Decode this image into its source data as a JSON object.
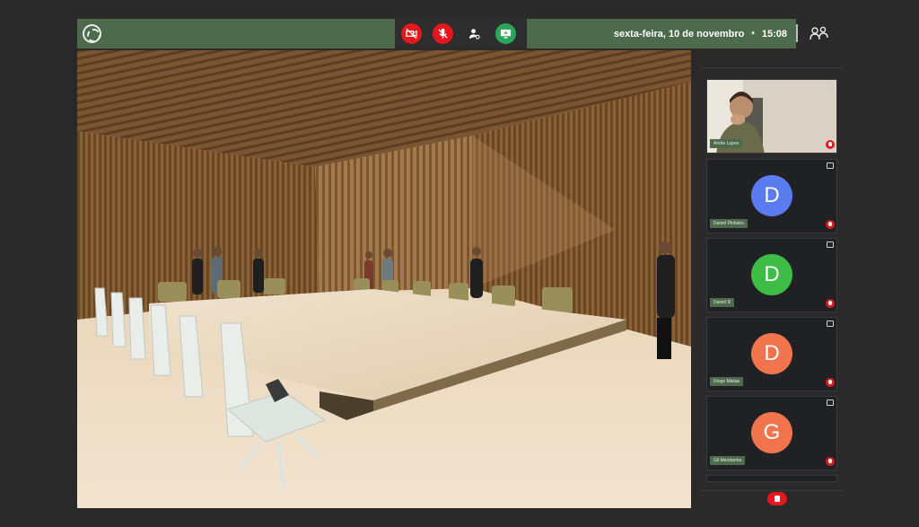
{
  "header": {
    "date": "sexta-feira, 10 de novembro",
    "separator": "•",
    "time": "15:08"
  },
  "controls": [
    {
      "id": "camera",
      "icon": "camera-off-icon",
      "color": "#e5161d"
    },
    {
      "id": "mic",
      "icon": "mic-off-icon",
      "color": "#e5161d"
    },
    {
      "id": "avatar",
      "icon": "person-settings-icon",
      "color": "transparent"
    },
    {
      "id": "present",
      "icon": "screen-share-icon",
      "color": "#2aa55a"
    }
  ],
  "participants": [
    {
      "name": "Andre Lopes",
      "initial": "",
      "avatar_color": "",
      "video": true,
      "muted": true
    },
    {
      "name": "Daniel Pinheiro",
      "initial": "D",
      "avatar_color": "#5b7cf0",
      "video": false,
      "muted": true
    },
    {
      "name": "Daniel R",
      "initial": "D",
      "avatar_color": "#3dbd45",
      "video": false,
      "muted": true
    },
    {
      "name": "Diogo Matias",
      "initial": "D",
      "avatar_color": "#f2744c",
      "video": false,
      "muted": true
    },
    {
      "name": "Gil Mendanha",
      "initial": "G",
      "avatar_color": "#f2744c",
      "video": false,
      "muted": true
    }
  ],
  "colors": {
    "brand_green": "#4d6b4c",
    "danger_red": "#e5161d",
    "success_green": "#2aa55a"
  }
}
